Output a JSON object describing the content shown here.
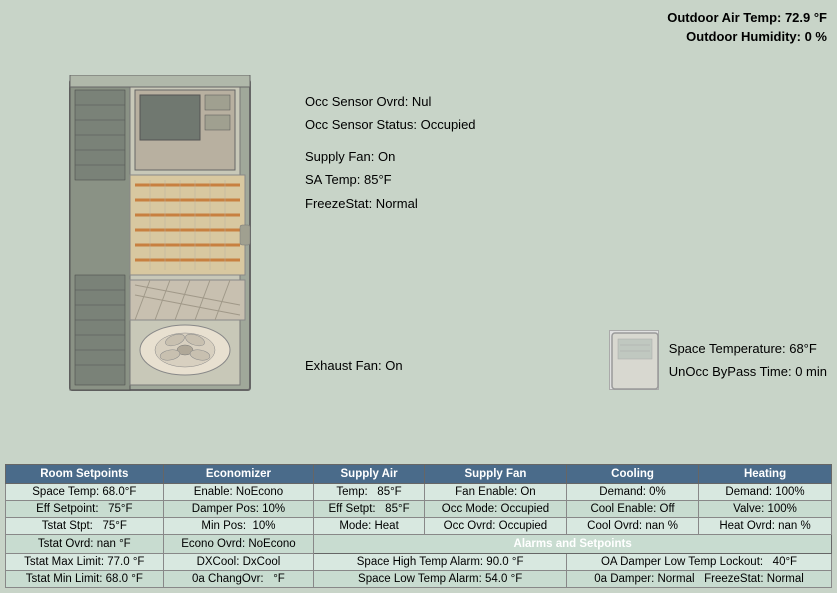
{
  "topRight": {
    "outdoorAirTemp": "Outdoor Air Temp: 72.9 °F",
    "outdoorHumidity": "Outdoor Humidity: 0 %"
  },
  "statusPanel": {
    "occSensorOvrd": "Occ Sensor Ovrd: Nul",
    "occSensorStatus": "Occ Sensor Status: Occupied",
    "supplyFan": "Supply Fan: On",
    "saTemp": "SA Temp:    85°F",
    "freezeStat": "FreezeStat: Normal"
  },
  "exhaustFan": "Exhaust Fan: On",
  "spaceTemp": {
    "temperature": "Space Temperature:    68°F",
    "bypassTime": "UnOcc ByPass Time: 0 min"
  },
  "table": {
    "headers": [
      "Room Setpoints",
      "Economizer",
      "Supply Air",
      "Supply Fan",
      "Cooling",
      "Heating"
    ],
    "rows": [
      [
        "Space Temp: 68.0°F",
        "Enable: NoEcono",
        "Temp:    85°F",
        "Fan Enable: On",
        "Demand: 0%",
        "Demand: 100%"
      ],
      [
        "Eff Setpoint:    75°F",
        "Damper Pos: 10%",
        "Eff Setpt:    85°F",
        "Occ Mode: Occupied",
        "Cool Enable: Off",
        "Valve: 100%"
      ],
      [
        "Tstat Stpt:    75°F",
        "Min Pos:  10%",
        "Mode: Heat",
        "Occ Ovrd: Occupied",
        "Cool Ovrd: nan %",
        "Heat Ovrd: nan %"
      ],
      [
        "Tstat Ovrd: nan °F",
        "Econo Ovrd: NoEcono",
        "",
        "",
        "",
        ""
      ],
      [
        "Tstat Max Limit: 77.0 °F",
        "DXCool: DxCool",
        "",
        "",
        "",
        ""
      ],
      [
        "Tstat Min Limit: 68.0 °F",
        "0a ChangOvr:    °F",
        "",
        "",
        "",
        ""
      ]
    ],
    "alarmRow": {
      "label": "Alarms and Setpoints",
      "colSpan": 4
    },
    "alarmData": [
      {
        "left": "Space High Temp Alarm: 90.0 °F",
        "right": "OA Damper Low Temp Lockout:    40°F"
      },
      {
        "left": "Space Low Temp Alarm: 54.0 °F",
        "right": "0a Damper: Normal    FreezeStat: Normal"
      }
    ]
  }
}
